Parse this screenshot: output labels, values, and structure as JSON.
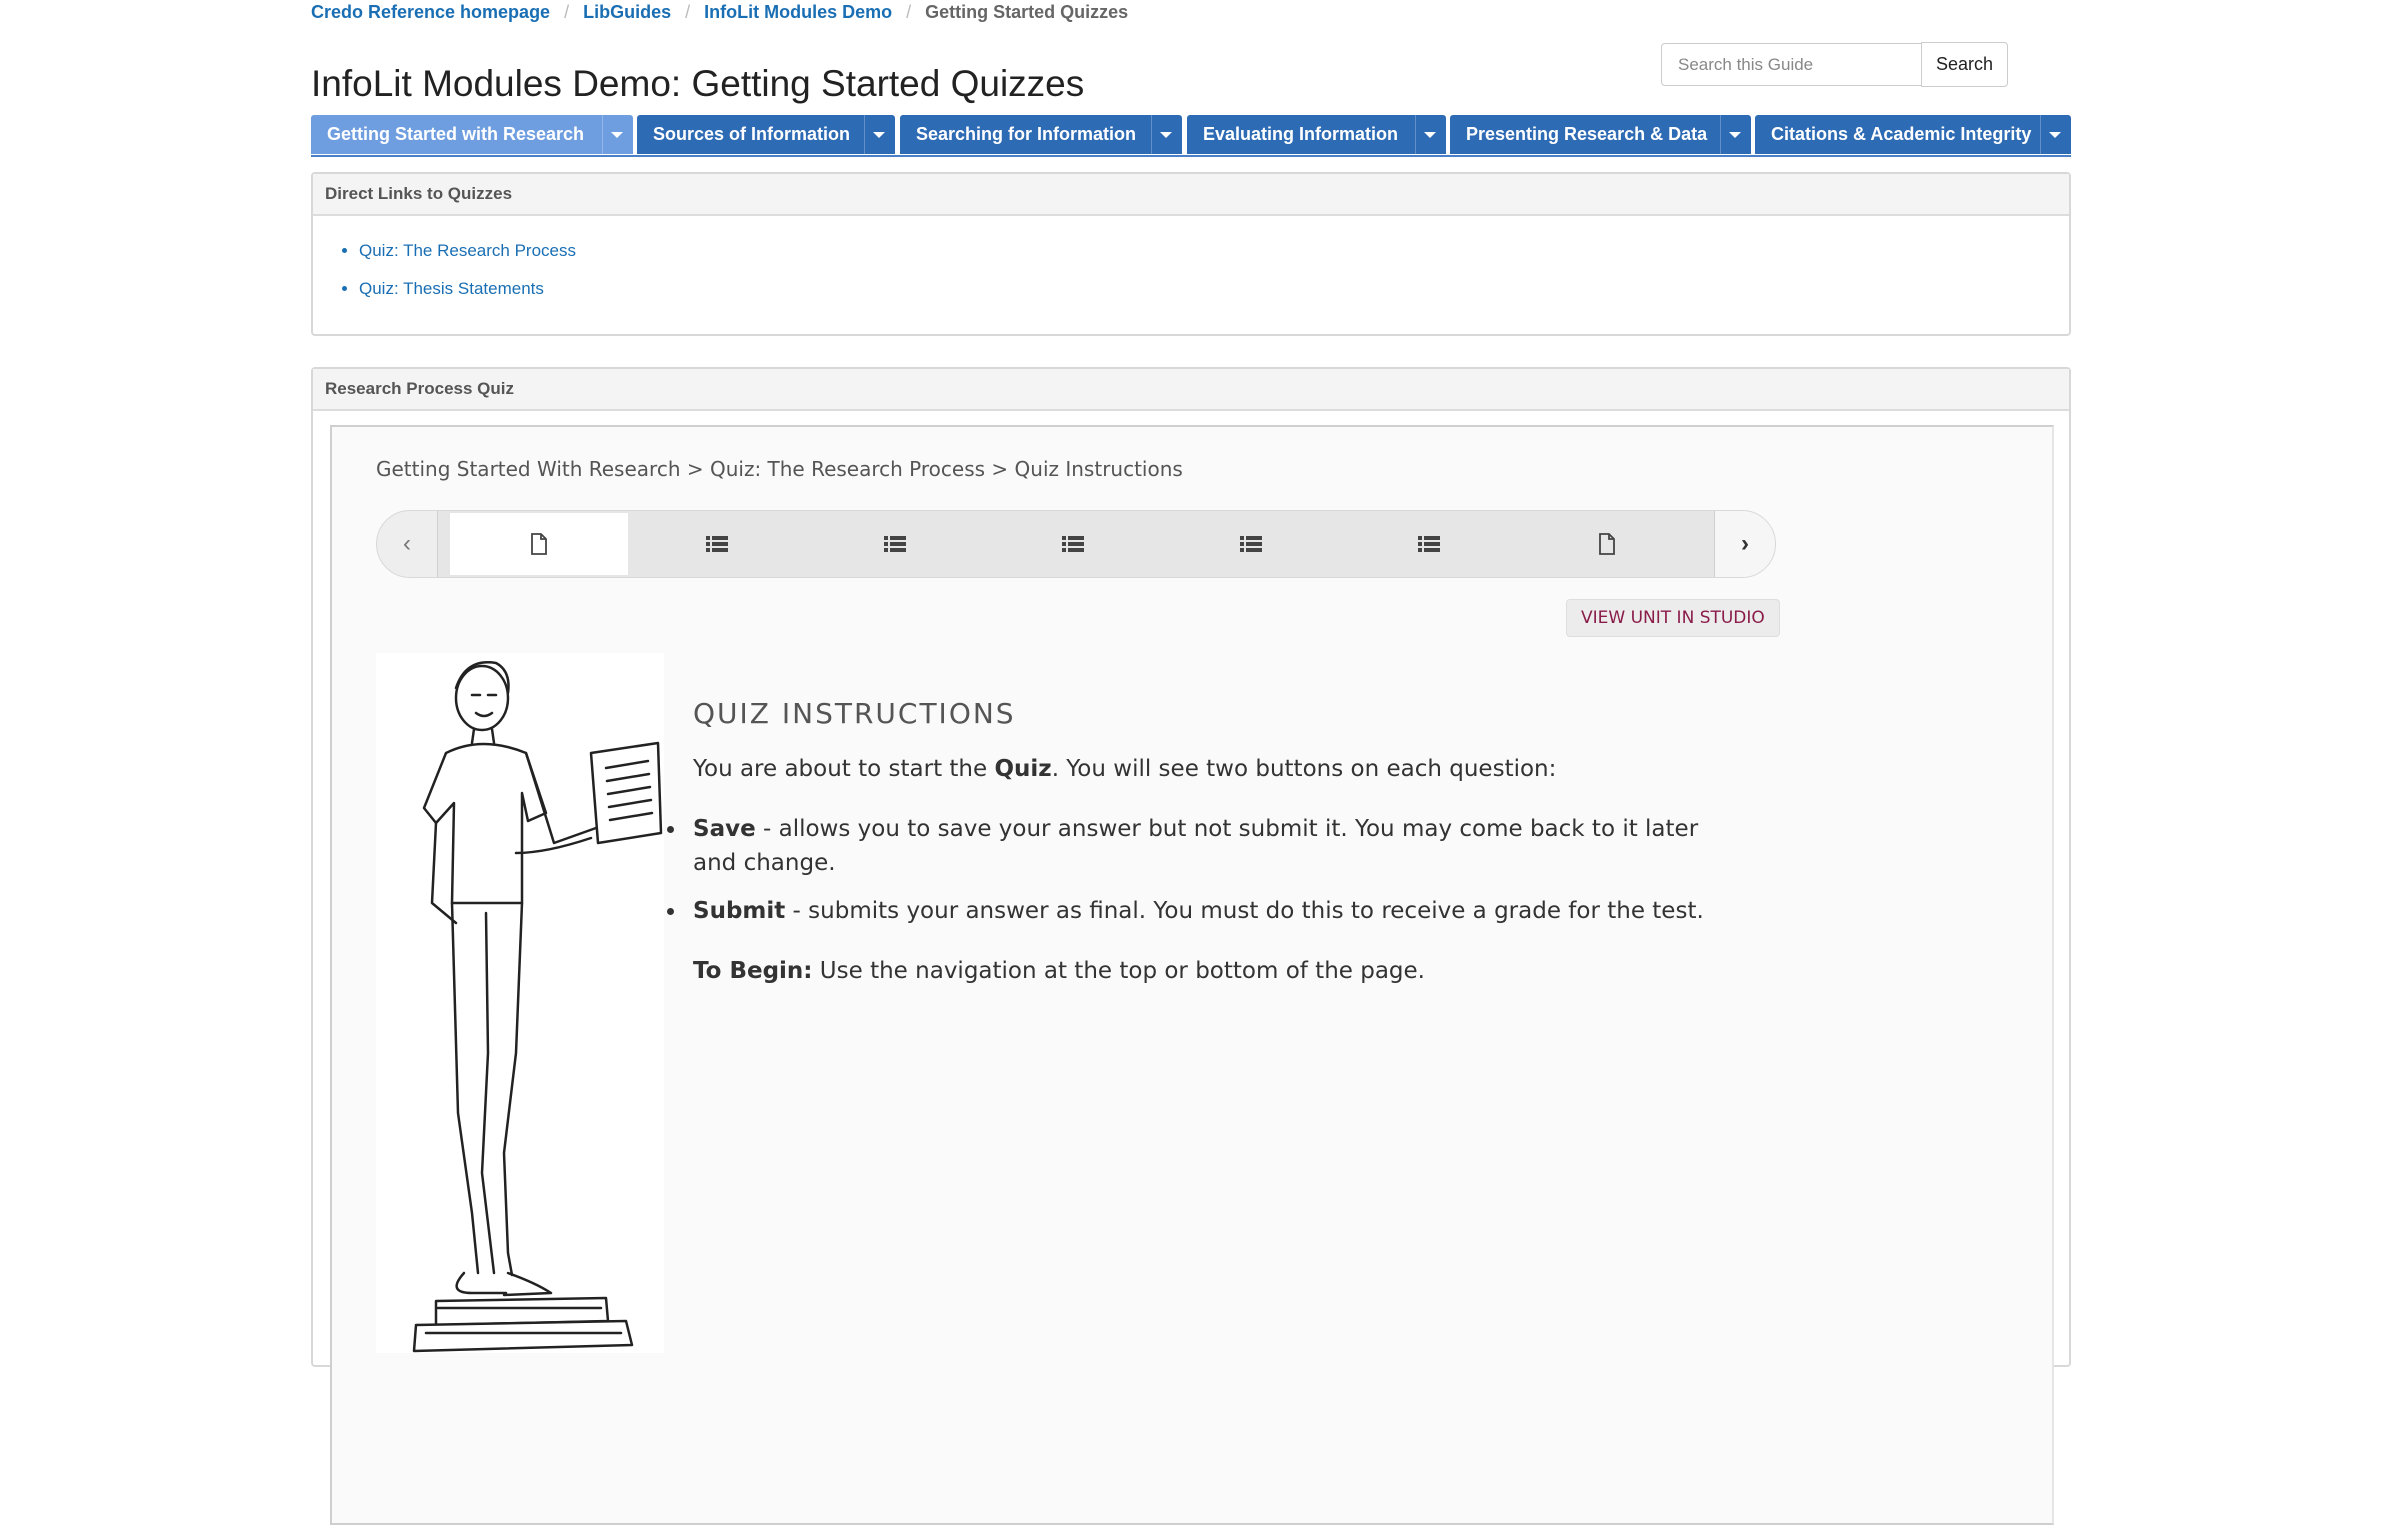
{
  "breadcrumb": {
    "items": [
      "Credo Reference homepage",
      "LibGuides",
      "InfoLit Modules Demo"
    ],
    "current": "Getting Started Quizzes",
    "separator": "/"
  },
  "page_title": "InfoLit Modules Demo: Getting Started Quizzes",
  "search": {
    "placeholder": "Search this Guide",
    "button_label": "Search"
  },
  "tabs": [
    {
      "label": "Getting Started with Research",
      "active": true
    },
    {
      "label": "Sources of Information",
      "active": false
    },
    {
      "label": "Searching for Information",
      "active": false
    },
    {
      "label": "Evaluating Information",
      "active": false
    },
    {
      "label": "Presenting Research & Data",
      "active": false
    },
    {
      "label": "Citations & Academic Integrity",
      "active": false
    }
  ],
  "links_panel": {
    "heading": "Direct Links to Quizzes",
    "links": [
      "Quiz: The Research Process",
      "Quiz: Thesis Statements"
    ]
  },
  "quiz_panel": {
    "heading": "Research Process Quiz",
    "module_breadcrumb": "Getting Started With Research > Quiz: The Research Process > Quiz Instructions",
    "nav_items": [
      "page-icon",
      "list-icon",
      "list-icon",
      "list-icon",
      "list-icon",
      "list-icon",
      "page-icon"
    ],
    "studio_button": "VIEW UNIT IN STUDIO",
    "content": {
      "title": "QUIZ INSTRUCTIONS",
      "intro_before": "You are about to start the ",
      "intro_bold": "Quiz",
      "intro_after": ". You will see two buttons on each question:",
      "bullets": [
        {
          "term": "Save",
          "text": " - allows you to save your answer but not submit it. You may come back to it later and change."
        },
        {
          "term": "Submit",
          "text": " - submits your answer as final. You must do this to receive a grade for the test."
        }
      ],
      "begin_label": "To Begin:",
      "begin_text": " Use the navigation at the top or bottom of the page."
    }
  },
  "colors": {
    "link": "#1a6fb4",
    "tab": "#2e6bb5",
    "tab_active": "#6f9ee0",
    "studio_text": "#8a1c4a"
  }
}
